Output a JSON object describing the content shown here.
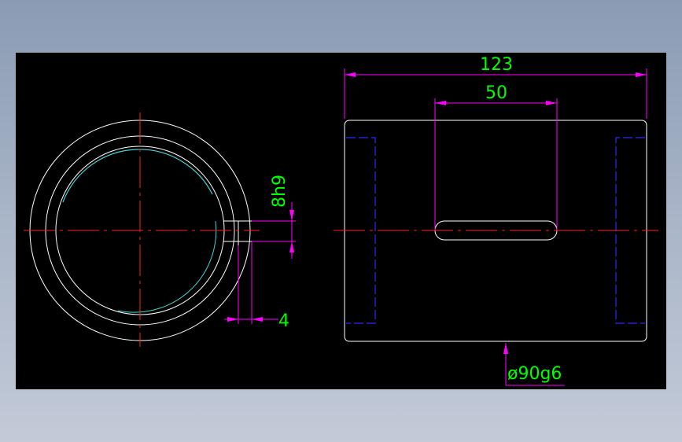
{
  "colors": {
    "background": "#000000",
    "outline": "#ffffff",
    "centerline": "#ff2020",
    "hidden": "#2b2bff",
    "dimension": "#ff00ff",
    "dimension_text": "#00ff00",
    "thread": "#3fd6d6"
  },
  "dimensions": {
    "overall_length": "123",
    "slot_length": "50",
    "keyway_width": "8h9",
    "keyway_depth": "4",
    "shaft_diameter": "ø90g6"
  }
}
